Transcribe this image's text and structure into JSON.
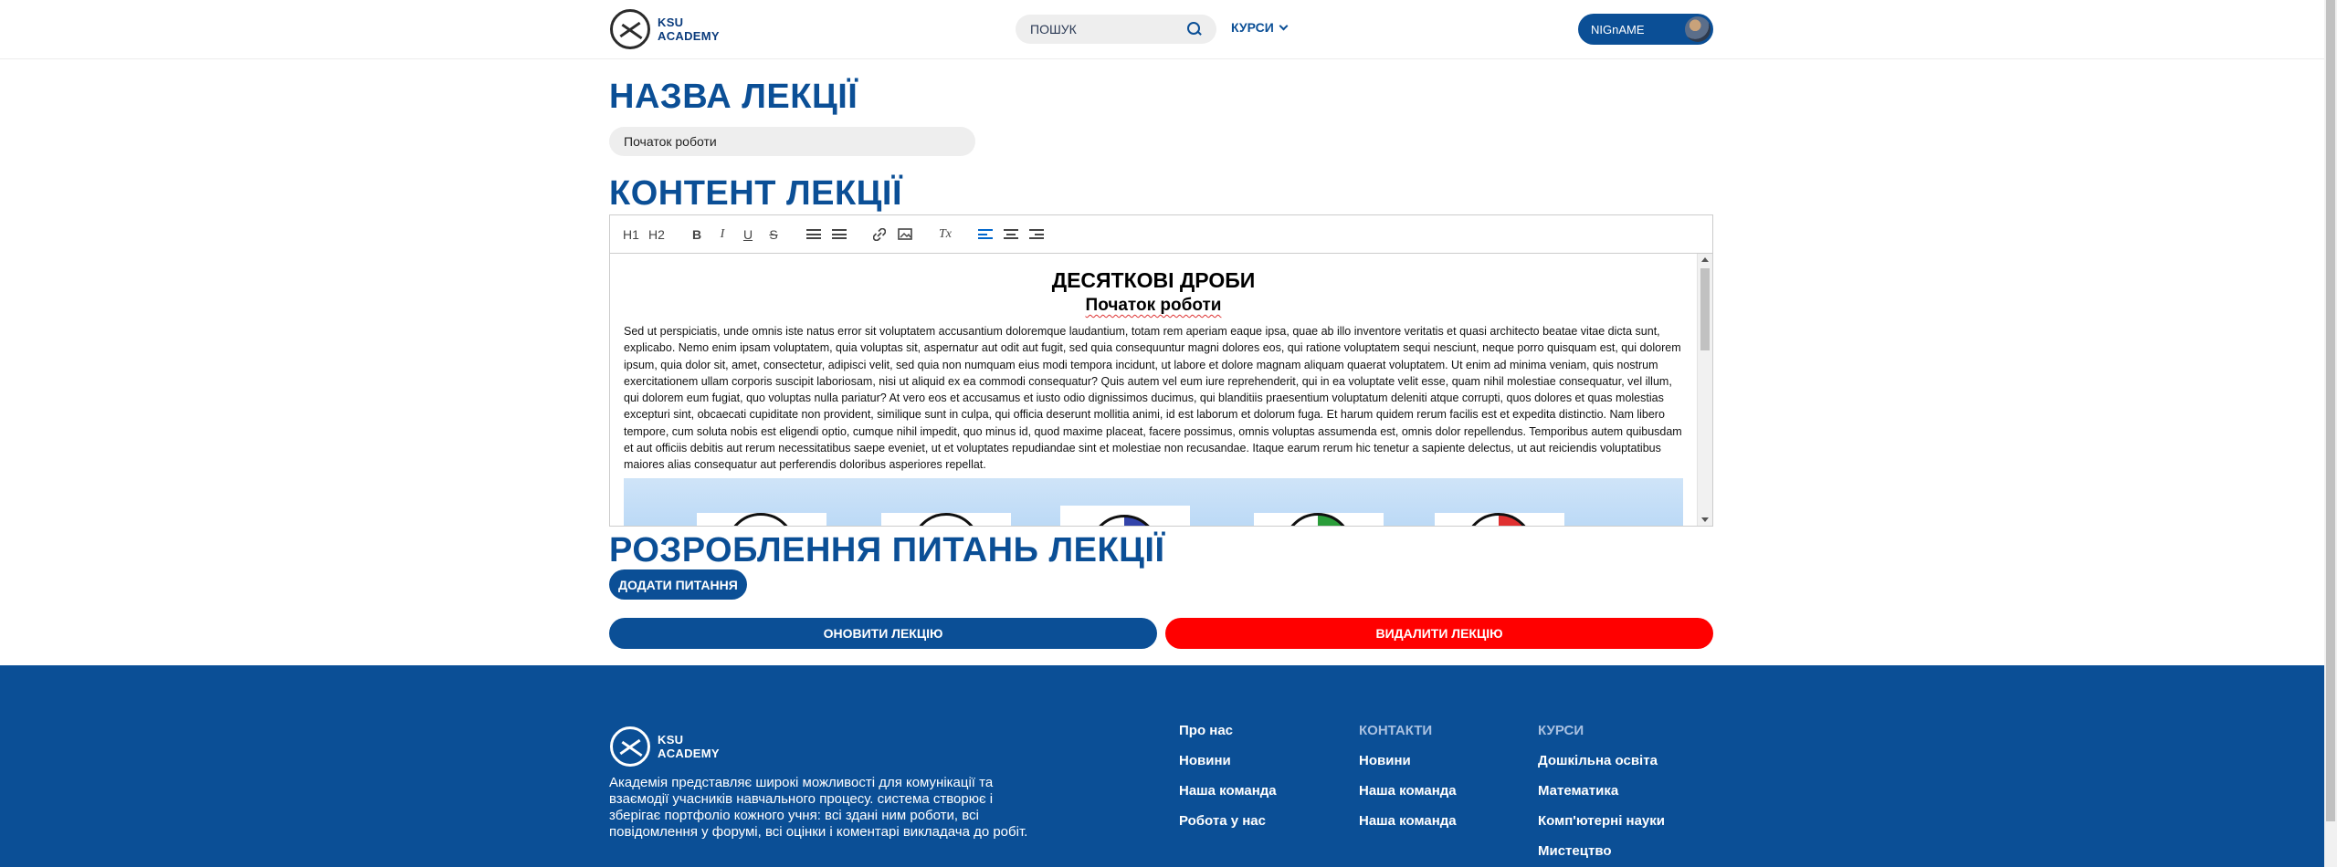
{
  "header": {
    "logo": [
      "KSU",
      "ACADEMY"
    ],
    "search_placeholder": "ПОШУК",
    "courses_menu": "КУРСИ",
    "user_name": "NIGnAME"
  },
  "main": {
    "lecture_name_heading": "НАЗВА ЛЕКЦІЇ",
    "lecture_name_value": "Початок роботи",
    "content_heading": "КОНТЕНТ ЛЕКЦІЇ",
    "toolbar": {
      "h1": "H1",
      "h2": "H2",
      "bold": "B",
      "italic": "I",
      "underline": "U",
      "strike": "S",
      "clear": "Tx"
    },
    "editor": {
      "title": "ДЕСЯТКОВІ ДРОБИ",
      "subtitle": "Початок роботи",
      "paragraph": "Sed ut perspiciatis, unde omnis iste natus error sit voluptatem accusantium doloremque laudantium, totam rem aperiam eaque ipsa, quae ab illo inventore veritatis et quasi architecto beatae vitae dicta sunt, explicabo. Nemo enim ipsam voluptatem, quia voluptas sit, aspernatur aut odit aut fugit, sed quia consequuntur magni dolores eos, qui ratione voluptatem sequi nesciunt, neque porro quisquam est, qui dolorem ipsum, quia dolor sit, amet, consectetur, adipisci velit, sed quia non numquam eius modi tempora incidunt, ut labore et dolore magnam aliquam quaerat voluptatem. Ut enim ad minima veniam, quis nostrum exercitationem ullam corporis suscipit laboriosam, nisi ut aliquid ex ea commodi consequatur? Quis autem vel eum iure reprehenderit, qui in ea voluptate velit esse, quam nihil molestiae consequatur, vel illum, qui dolorem eum fugiat, quo voluptas nulla pariatur? At vero eos et accusamus et iusto odio dignissimos ducimus, qui blanditiis praesentium voluptatum deleniti atque corrupti, quos dolores et quas molestias excepturi sint, obcaecati cupiditate non provident, similique sunt in culpa, qui officia deserunt mollitia animi, id est laborum et dolorum fuga. Et harum quidem rerum facilis est et expedita distinctio. Nam libero tempore, cum soluta nobis est eligendi optio, cumque nihil impedit, quo minus id, quod maxime placeat, facere possimus, omnis voluptas assumenda est, omnis dolor repellendus. Temporibus autem quibusdam et aut officiis debitis aut rerum necessitatibus saepe eveniet, ut et voluptates repudiandae sint et molestiae non recusandae. Itaque earum rerum hic tenetur a sapiente delectus, ut aut reiciendis voluptatibus maiores alias consequatur aut perferendis doloribus asperiores repellat."
    },
    "questions_heading": "РОЗРОБЛЕННЯ ПИТАНЬ ЛЕКЦІЇ",
    "add_question_label": "ДОДАТИ ПИТАННЯ",
    "update_label": "ОНОВИТИ ЛЕКЦІЮ",
    "delete_label": "ВИДАЛИТИ ЛЕКЦІЮ"
  },
  "footer": {
    "logo": [
      "KSU",
      "ACADEMY"
    ],
    "about": "Академія представляє широкі можливості для комунікації та взаємодії учасників навчального процесу. система створює і зберігає портфоліо кожного учня: всі здані ним роботи, всі повідомлення у форумі, всі оцінки і коментарі викладача до робіт.",
    "col1": {
      "title": "Про нас",
      "links": [
        "Новини",
        "Наша команда",
        "Робота у нас"
      ]
    },
    "col2": {
      "title": "КОНТАКТИ",
      "links": [
        "Новини",
        "Наша команда",
        "Наша команда"
      ]
    },
    "col3": {
      "title": "КУРСИ",
      "links": [
        "Дошкільна освіта",
        "Математика",
        "Комп'ютерні науки",
        "Мистецтво"
      ]
    }
  },
  "colors": {
    "brand": "#0b4f96",
    "danger": "#ff0000"
  }
}
